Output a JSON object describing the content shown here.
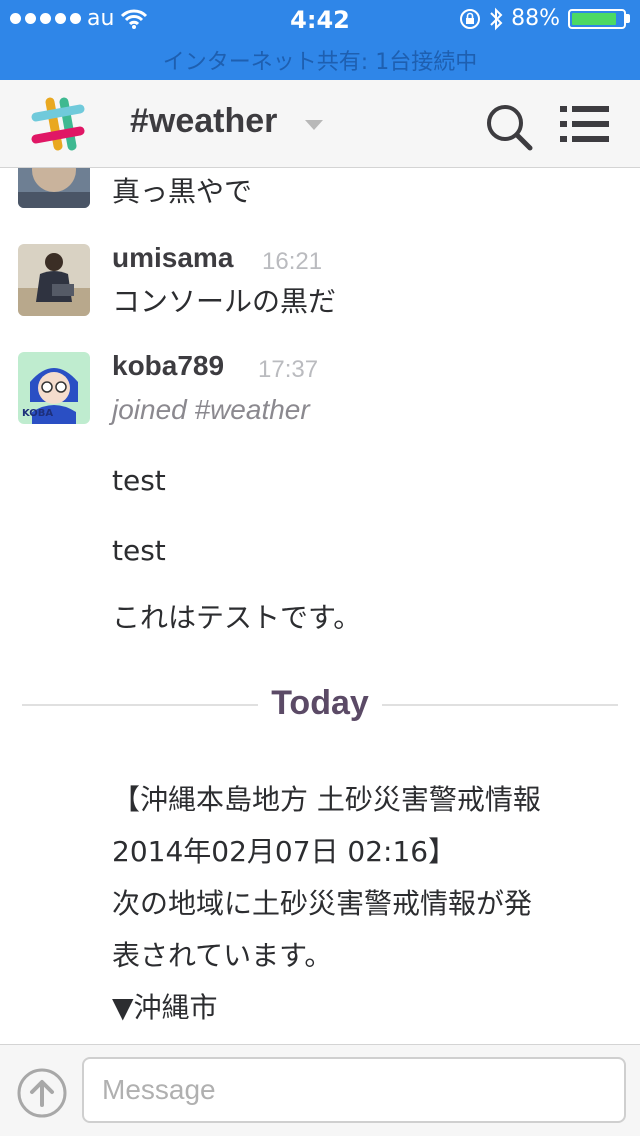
{
  "status_bar": {
    "carrier": "au",
    "time": "4:42",
    "battery_percent": "88%",
    "battery_level": 0.88,
    "tethering_text": "インターネット共有: 1台接続中"
  },
  "nav": {
    "channel": "#weather"
  },
  "messages": {
    "m1": {
      "text": "真っ黒やで"
    },
    "m2": {
      "user": "umisama",
      "time": "16:21",
      "text": "コンソールの黒だ"
    },
    "m3": {
      "user": "koba789",
      "time": "17:37",
      "joined": "joined #weather",
      "lines": [
        "test",
        "test",
        "これはテストです。"
      ]
    },
    "divider": "Today",
    "m4": {
      "text": "【沖縄本島地方 土砂災害警戒情報\n2014年02月07日 02:16】\n次の地域に土砂災害警戒情報が発\n表されています。\n▼沖縄市"
    }
  },
  "composer": {
    "placeholder": "Message"
  },
  "colors": {
    "status_bar": "#2f86e8",
    "today_divider": "#5b4a66",
    "battery_fill": "#4cd964"
  }
}
